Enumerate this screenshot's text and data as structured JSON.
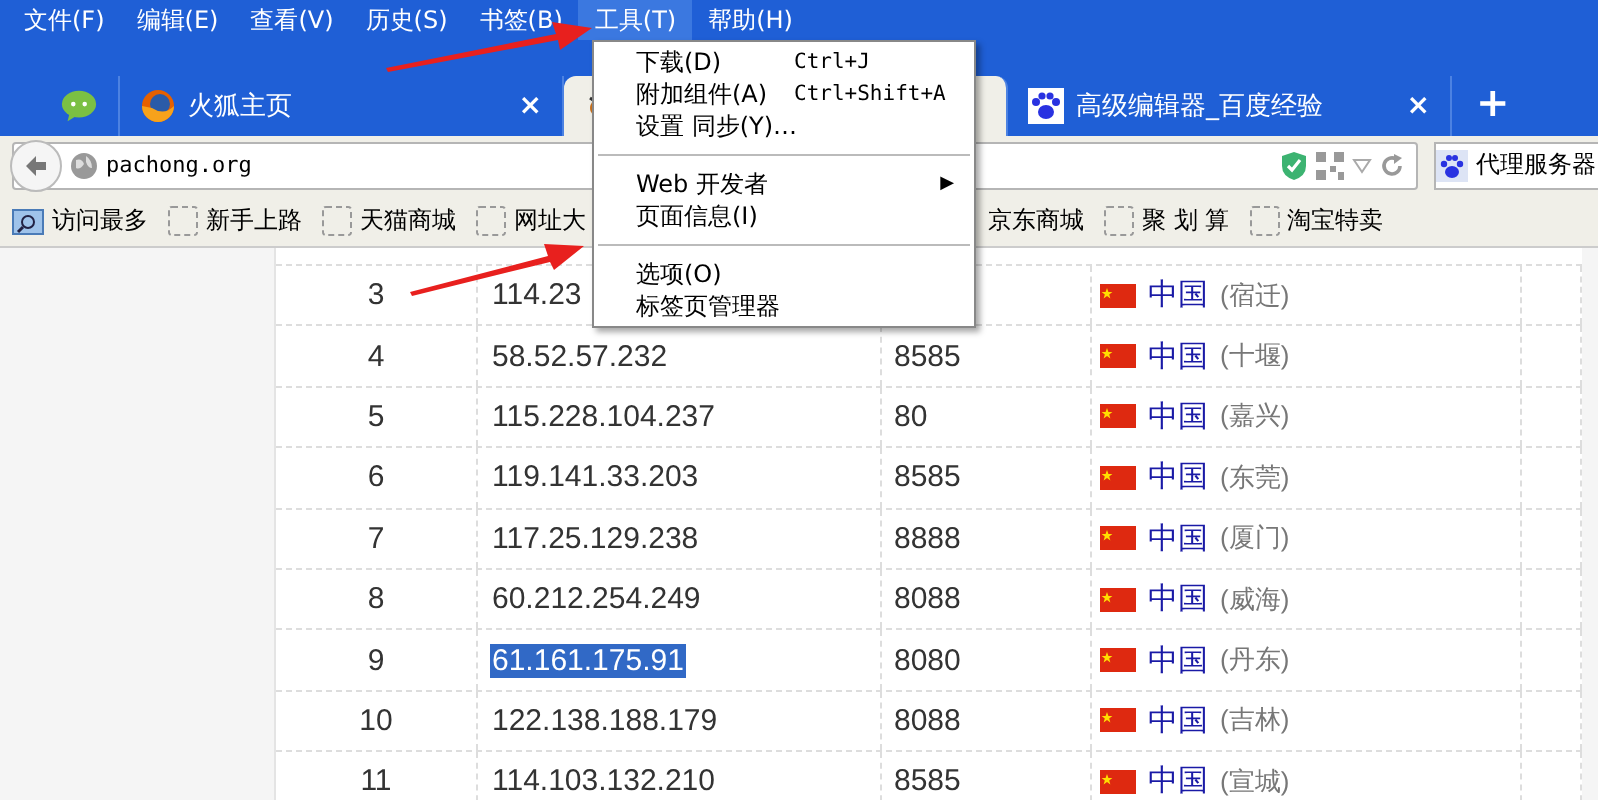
{
  "menubar": [
    {
      "label": "文件(F)",
      "selected": false
    },
    {
      "label": "编辑(E)",
      "selected": false
    },
    {
      "label": "查看(V)",
      "selected": false
    },
    {
      "label": "历史(S)",
      "selected": false
    },
    {
      "label": "书签(B)",
      "selected": false
    },
    {
      "label": "工具(T)",
      "selected": true
    },
    {
      "label": "帮助(H)",
      "selected": false
    }
  ],
  "tabs": [
    {
      "kind": "pinned",
      "selected": false
    },
    {
      "kind": "tab",
      "title": "火狐主页",
      "close": "×",
      "selected": false
    },
    {
      "kind": "tab",
      "selected": true
    },
    {
      "kind": "tab",
      "title": "高级编辑器_百度经验",
      "close": "×",
      "selected": false
    }
  ],
  "new_tab": "+",
  "address": {
    "value": "pachong.org"
  },
  "search": {
    "value": "代理服务器"
  },
  "bookmarks": [
    {
      "kind": "folder",
      "label": "访问最多"
    },
    {
      "kind": "page",
      "label": "新手上路"
    },
    {
      "kind": "page",
      "label": "天猫商城"
    },
    {
      "kind": "page",
      "label": "网址大"
    },
    {
      "kind": "plain",
      "label": "京东商城"
    },
    {
      "kind": "page",
      "label": "聚 划 算"
    },
    {
      "kind": "page",
      "label": "淘宝特卖"
    }
  ],
  "tools_menu": [
    {
      "kind": "item",
      "label": "下载(D)",
      "shortcut": "Ctrl+J"
    },
    {
      "kind": "item",
      "label": "附加组件(A)",
      "shortcut": "Ctrl+Shift+A"
    },
    {
      "kind": "item",
      "label": "设置 同步(Y)…"
    },
    {
      "kind": "separator"
    },
    {
      "kind": "item",
      "label": "Web 开发者",
      "submenu": "▶"
    },
    {
      "kind": "item",
      "label": "页面信息(I)"
    },
    {
      "kind": "separator"
    },
    {
      "kind": "item",
      "label": "选项(O)"
    },
    {
      "kind": "item",
      "label": "标签页管理器"
    }
  ],
  "table": {
    "rows": [
      {
        "number": "3",
        "ip": "114.23",
        "country": "中国",
        "city": "(宿迁)",
        "selected": false
      },
      {
        "number": "4",
        "ip": "58.52.57.232",
        "port": "8585",
        "country": "中国",
        "city": "(十堰)",
        "selected": false
      },
      {
        "number": "5",
        "ip": "115.228.104.237",
        "port": "80",
        "country": "中国",
        "city": "(嘉兴)",
        "selected": false
      },
      {
        "number": "6",
        "ip": "119.141.33.203",
        "port": "8585",
        "country": "中国",
        "city": "(东莞)",
        "selected": false
      },
      {
        "number": "7",
        "ip": "117.25.129.238",
        "port": "8888",
        "country": "中国",
        "city": "(厦门)",
        "selected": false
      },
      {
        "number": "8",
        "ip": "60.212.254.249",
        "port": "8088",
        "country": "中国",
        "city": "(威海)",
        "selected": false
      },
      {
        "number": "9",
        "ip": "61.161.175.91",
        "port": "8080",
        "country": "中国",
        "city": "(丹东)",
        "selected": true
      },
      {
        "number": "10",
        "ip": "122.138.188.179",
        "port": "8088",
        "country": "中国",
        "city": "(吉林)",
        "selected": false
      },
      {
        "number": "11",
        "ip": "114.103.132.210",
        "port": "8585",
        "country": "中国",
        "city": "(宣城)",
        "selected": false
      }
    ]
  }
}
